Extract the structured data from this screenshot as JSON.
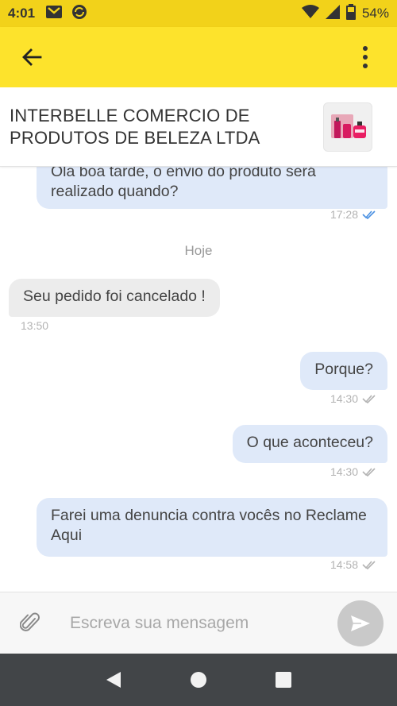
{
  "status_bar": {
    "time": "4:01",
    "battery": "54%",
    "icons": [
      "gmail-icon",
      "sync-app-icon",
      "wifi-icon",
      "signal-icon",
      "battery-icon"
    ]
  },
  "app_bar": {
    "back_icon": "arrow-back-icon",
    "menu_icon": "more-vert-icon",
    "color": "#fde32c"
  },
  "seller": {
    "name": "INTERBELLE COMERCIO DE PRODUTOS DE BELEZA LTDA"
  },
  "messages": [
    {
      "direction": "out",
      "text": "Ola boa tarde, o envio do produto será realizado quando?",
      "time": "17:28",
      "status": "read"
    },
    {
      "direction": "in",
      "text": "Seu pedido foi cancelado !",
      "time": "13:50"
    },
    {
      "direction": "out",
      "text": "Porque?",
      "time": "14:30",
      "status": "delivered"
    },
    {
      "direction": "out",
      "text": "O que aconteceu?",
      "time": "14:30",
      "status": "delivered"
    },
    {
      "direction": "out",
      "text": "Farei uma denuncia contra vocês no Reclame Aqui",
      "time": "14:58",
      "status": "delivered"
    }
  ],
  "date_separator": "Hoje",
  "composer": {
    "placeholder": "Escreva sua mensagem",
    "attach_icon": "paperclip-icon",
    "send_icon": "send-icon"
  },
  "nav_bar": {
    "buttons": [
      "back-triangle-icon",
      "home-circle-icon",
      "recents-square-icon"
    ]
  },
  "colors": {
    "accent": "#fde32c",
    "outgoing_bubble": "#dfe9f9",
    "incoming_bubble": "#ececec",
    "read_check": "#4a90e2"
  }
}
